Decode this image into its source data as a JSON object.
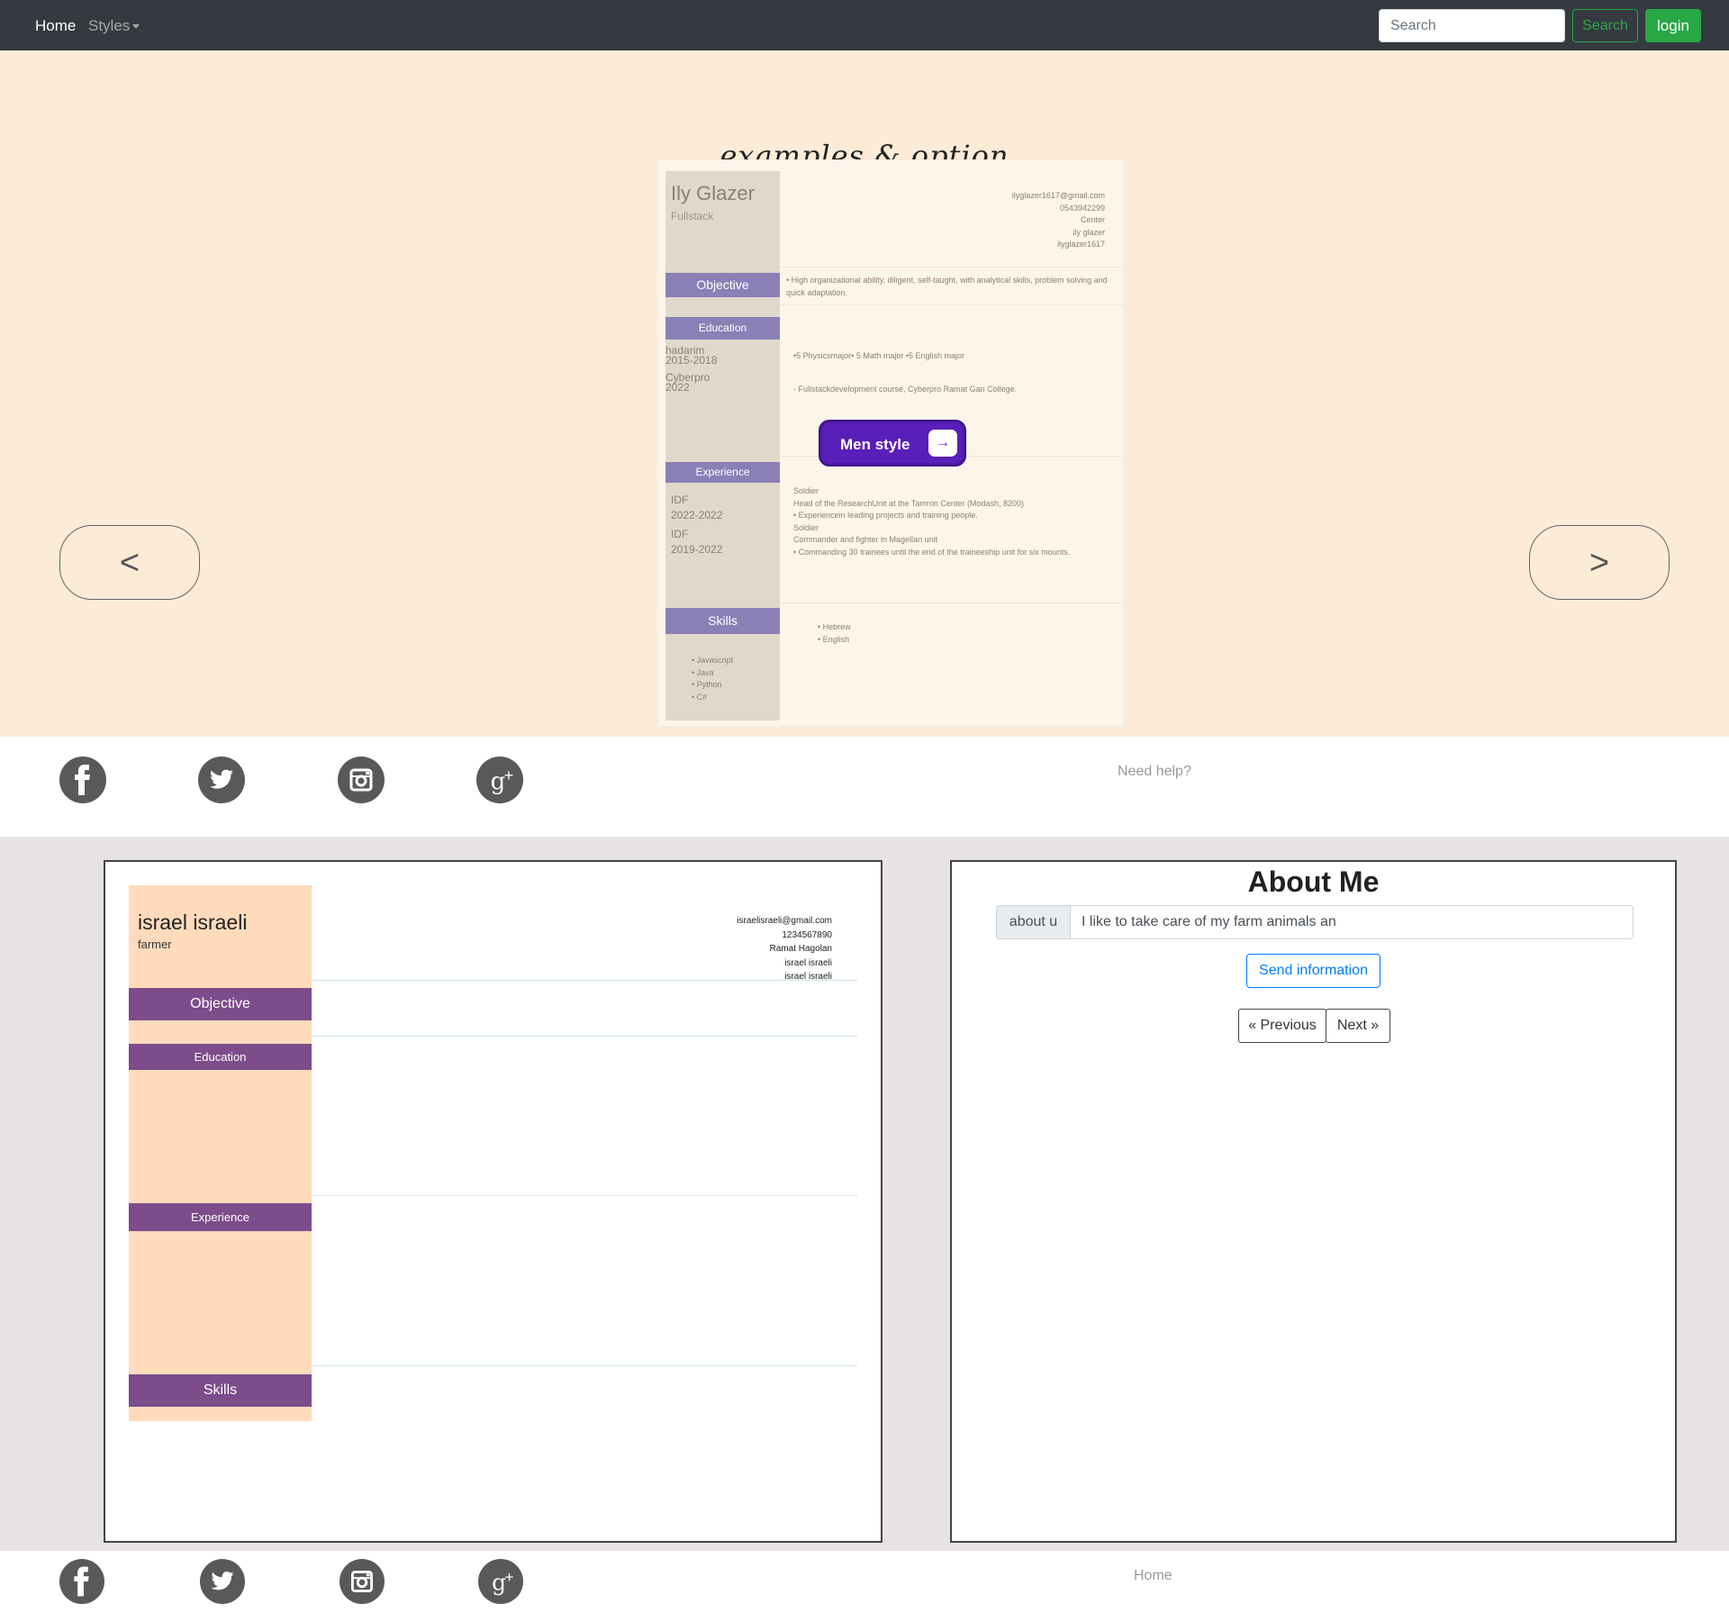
{
  "navbar": {
    "home": "Home",
    "styles": "Styles",
    "search_placeholder": "Search",
    "search_button": "Search",
    "login_button": "login"
  },
  "hero": {
    "title": "examples & option",
    "prev_label": "<",
    "next_label": ">",
    "background": "#fbebd7",
    "preview": {
      "name": "Ily Glazer",
      "role": "Fullstack",
      "contact": [
        "ilyglazer1617@gmail.com",
        "0543942299",
        "Center",
        "ily glazer",
        "ilyglazer1617"
      ],
      "sections": {
        "objective": "Objective",
        "education": "Education",
        "experience": "Experience",
        "skills": "Skills"
      },
      "objective_text": "• High organizational ability, diligent, self-taught, with analytical skills, problem solving and quick adaptation.",
      "education_side": [
        "hadarim",
        "2015-2018",
        "Cyberpro",
        "2022"
      ],
      "education_text": [
        "•5 Physicsmajor• 5 Math major •5 English major",
        "- Fullstackdevelopment course, Cyberpro Ramat Gan College."
      ],
      "experience_side": [
        "IDF",
        "2022-2022",
        "IDF",
        "2019-2022"
      ],
      "experience_text": [
        "Soldier",
        "Head of the ResearchUnit at the Tamron Center (Modash, 8200)",
        "• Experiencein leading projects and training people.",
        "Soldier",
        "Commander and fighter in Magellan unit",
        "• Commanding 30 trainees until the end of the traineeship unit for six mounts."
      ],
      "languages": [
        "• Hebrew",
        "• English"
      ],
      "skills_list": [
        "• Javascript",
        "• Java",
        "• Python",
        "• C#"
      ],
      "cta_label": "Men style",
      "cta_arrow": "→",
      "cta_color": "#5a1eba"
    }
  },
  "footer_top": {
    "social": [
      "facebook-icon",
      "twitter-icon",
      "instagram-icon",
      "google-plus-icon"
    ],
    "help_text": "Need help?"
  },
  "resume": {
    "name": "israel israeli",
    "role": "farmer",
    "contact": [
      "israelisraeli@gmail.com",
      "1234567890",
      "Ramat Hagolan",
      "israel israeli",
      "israel israeli"
    ],
    "sections": {
      "objective": "Objective",
      "education": "Education",
      "experience": "Experience",
      "skills": "Skills"
    },
    "side_color": "#ffdbbc",
    "bar_color": "#7d4c8a"
  },
  "about": {
    "title": "About Me",
    "addon": "about u",
    "value": "I like to take care of my farm animals an",
    "send_button": "Send information",
    "previous_button": "« Previous",
    "next_button": "Next »"
  },
  "footer_bottom": {
    "social": [
      "facebook-icon",
      "twitter-icon",
      "instagram-icon",
      "google-plus-icon"
    ],
    "home_link": "Home"
  }
}
